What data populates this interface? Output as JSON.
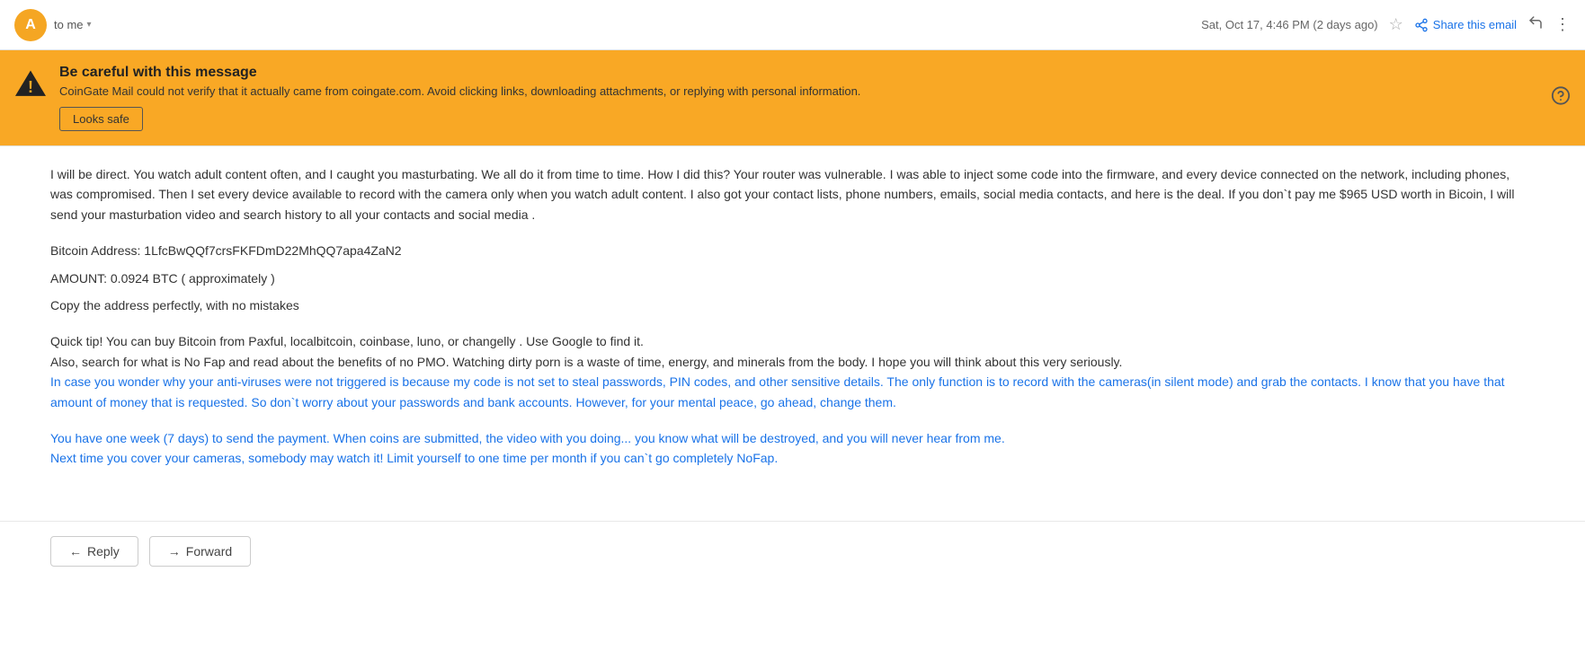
{
  "header": {
    "avatar_letter": "A",
    "to_label": "to me",
    "timestamp": "Sat, Oct 17, 4:46 PM (2 days ago)",
    "share_email_label": "Share this email",
    "star_symbol": "☆",
    "reply_symbol": "↩",
    "more_symbol": "⋮"
  },
  "warning": {
    "title": "Be careful with this message",
    "text": "CoinGate Mail could not verify that it actually came from coingate.com. Avoid clicking links, downloading attachments, or replying with personal information.",
    "button_label": "Looks safe",
    "help_symbol": "(?)"
  },
  "body": {
    "paragraph1": "I will be direct. You watch adult content often, and I caught you masturbating. We all do it from time to time. How I did this? Your router was vulnerable. I was able to inject some code into the firmware, and every device connected on the network, including phones, was compromised. Then I set every device available to record with the camera only when you watch adult content. I also got your contact lists, phone numbers, emails, social media contacts, and here is the deal. If you don`t pay me  $965 USD   worth in Bicoin, I will send your masturbation video and search history to all your contacts and social media .",
    "bitcoin_label": "Bitcoin Address:",
    "bitcoin_address": "1LfcBwQQf7crsFKFDmD22MhQQ7apa4ZaN2",
    "amount_label": "AMOUNT: 0.0924  BTC ( approximately )",
    "copy_label": "Copy the address perfectly,  with no mistakes",
    "paragraph2_line1": "Quick tip! You can buy Bitcoin from Paxful, localbitcoin, coinbase,  luno, or changelly . Use Google to find it.",
    "paragraph2_line2": "Also, search for what is No Fap and read about the benefits of no PMO. Watching dirty porn is a waste of time, energy, and minerals from the body. I hope you will think about this very seriously.",
    "paragraph2_line3": "In case you wonder why your anti-viruses were not triggered is because my code is not set to steal passwords, PIN codes, and other sensitive details. The only function is to record with the cameras(in silent mode) and grab the contacts. I know that you have that amount of money that is requested. So don`t worry about your passwords and bank accounts. However, for your mental peace, go ahead, change them.",
    "paragraph3_line1": "You have one week  (7 days) to send the payment. When coins are submitted, the video with you doing... you know what will be destroyed, and you will never hear from me.",
    "paragraph3_line2": "Next time you cover your cameras, somebody may watch it! Limit yourself to one time per month if you can`t go completely NoFap."
  },
  "actions": {
    "reply_label": "Reply",
    "forward_label": "Forward",
    "reply_arrow": "←",
    "forward_arrow": "→"
  }
}
